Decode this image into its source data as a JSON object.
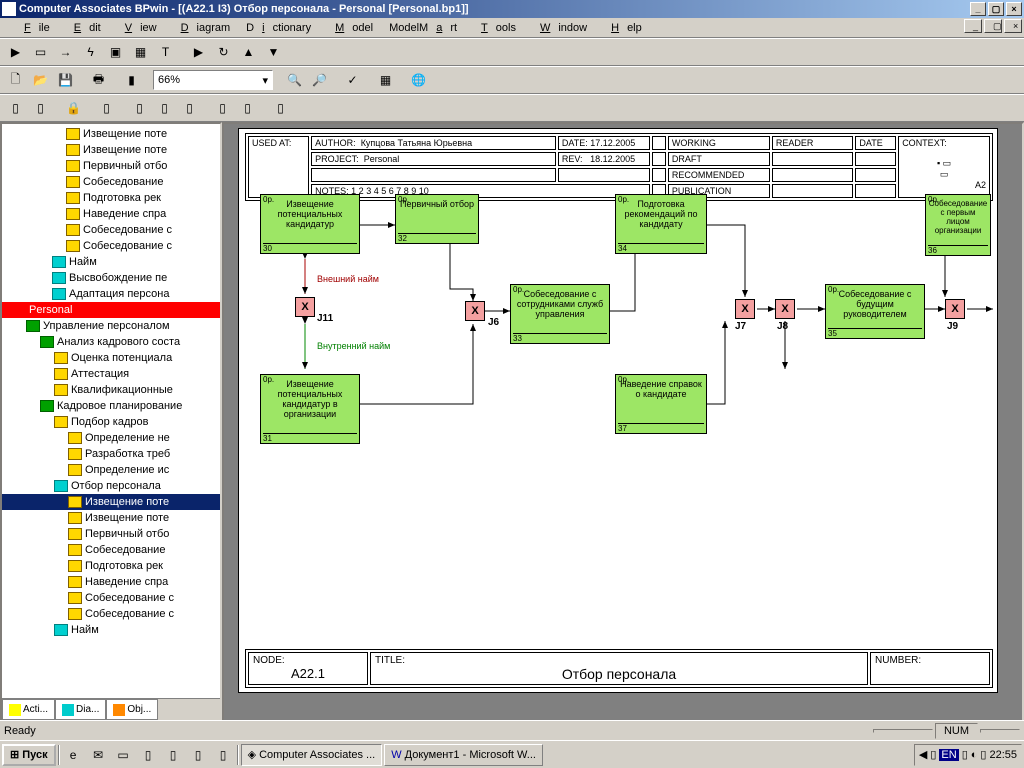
{
  "title": "Computer Associates BPwin - [(A22.1 I3) Отбор персонала - Personal  [Personal.bp1]]",
  "menu": [
    "File",
    "Edit",
    "View",
    "Diagram",
    "Dictionary",
    "Model",
    "ModelMart",
    "Tools",
    "Window",
    "Help"
  ],
  "zoom": "66%",
  "tree": [
    {
      "indent": 64,
      "ic": "ic-yellow",
      "t": "Извещение поте"
    },
    {
      "indent": 64,
      "ic": "ic-yellow",
      "t": "Извещение поте"
    },
    {
      "indent": 64,
      "ic": "ic-yellow",
      "t": "Первичный отбо"
    },
    {
      "indent": 64,
      "ic": "ic-yellow",
      "t": "Собеседование"
    },
    {
      "indent": 64,
      "ic": "ic-yellow",
      "t": "Подготовка рек"
    },
    {
      "indent": 64,
      "ic": "ic-yellow",
      "t": "Наведение спра"
    },
    {
      "indent": 64,
      "ic": "ic-yellow",
      "t": "Собеседование с"
    },
    {
      "indent": 64,
      "ic": "ic-yellow",
      "t": "Собеседование с"
    },
    {
      "indent": 50,
      "ic": "ic-cyan",
      "t": "Найм"
    },
    {
      "indent": 50,
      "ic": "ic-cyan",
      "t": "Высвобождение пе"
    },
    {
      "indent": 50,
      "ic": "ic-cyan",
      "t": "Адаптация персона"
    },
    {
      "indent": 10,
      "ic": "",
      "t": "Personal",
      "cls": "sel-red"
    },
    {
      "indent": 24,
      "ic": "ic-green",
      "t": "Управление персоналом"
    },
    {
      "indent": 38,
      "ic": "ic-green",
      "t": "Анализ кадрового соста"
    },
    {
      "indent": 52,
      "ic": "ic-yellow",
      "t": "Оценка потенциала"
    },
    {
      "indent": 52,
      "ic": "ic-yellow",
      "t": "Аттестация"
    },
    {
      "indent": 52,
      "ic": "ic-yellow",
      "t": "Квалификационные"
    },
    {
      "indent": 38,
      "ic": "ic-green",
      "t": "Кадровое планирование"
    },
    {
      "indent": 52,
      "ic": "ic-yellow",
      "t": "Подбор кадров"
    },
    {
      "indent": 66,
      "ic": "ic-yellow",
      "t": "Определение не"
    },
    {
      "indent": 66,
      "ic": "ic-yellow",
      "t": "Разработка треб"
    },
    {
      "indent": 66,
      "ic": "ic-yellow",
      "t": "Определение ис"
    },
    {
      "indent": 52,
      "ic": "ic-cyan",
      "t": "Отбор персонала"
    },
    {
      "indent": 66,
      "ic": "ic-yellow",
      "t": "Извещение поте",
      "cls": "sel-blue"
    },
    {
      "indent": 66,
      "ic": "ic-yellow",
      "t": "Извещение поте"
    },
    {
      "indent": 66,
      "ic": "ic-yellow",
      "t": "Первичный отбо"
    },
    {
      "indent": 66,
      "ic": "ic-yellow",
      "t": "Собеседование"
    },
    {
      "indent": 66,
      "ic": "ic-yellow",
      "t": "Подготовка рек"
    },
    {
      "indent": 66,
      "ic": "ic-yellow",
      "t": "Наведение спра"
    },
    {
      "indent": 66,
      "ic": "ic-yellow",
      "t": "Собеседование с"
    },
    {
      "indent": 66,
      "ic": "ic-yellow",
      "t": "Собеседование с"
    },
    {
      "indent": 52,
      "ic": "ic-cyan",
      "t": "Найм"
    }
  ],
  "tabs": [
    {
      "l": "Acti..."
    },
    {
      "l": "Dia..."
    },
    {
      "l": "Obj..."
    }
  ],
  "header": {
    "used_at": "USED AT:",
    "author_l": "AUTHOR:",
    "author": "Купцова Татьяна Юрьевна",
    "project_l": "PROJECT:",
    "project": "Personal",
    "date_l": "DATE:",
    "date": "17.12.2005",
    "rev_l": "REV:",
    "rev": "18.12.2005",
    "working": "WORKING",
    "draft": "DRAFT",
    "recommended": "RECOMMENDED",
    "publication": "PUBLICATION",
    "reader": "READER",
    "hdate": "DATE",
    "context": "CONTEXT:",
    "notes": "NOTES:  1  2  3  4  5  6  7  8  9  10",
    "a2": "A2"
  },
  "boxes": {
    "b30": {
      "t": "Извещение потенциальных кандидатур",
      "n": "30"
    },
    "b31": {
      "t": "Извещение потенциальных кандидатур в организации",
      "n": "31"
    },
    "b32": {
      "t": "Первичный отбор",
      "n": "32"
    },
    "b33": {
      "t": "Собеседование с сотрудниками служб управления",
      "n": "33"
    },
    "b34": {
      "t": "Подготовка рекомендаций по кандидату",
      "n": "34"
    },
    "b35": {
      "t": "Собеседование с будущим руководителем",
      "n": "35"
    },
    "b36": {
      "t": "Собеседование с первым лицом организации",
      "n": "36"
    },
    "b37": {
      "t": "Наведение справок о кандидате",
      "n": "37"
    }
  },
  "junc": {
    "x": "X",
    "j11": "J11",
    "j6": "J6",
    "j7": "J7",
    "j8": "J8",
    "j9": "J9"
  },
  "labels": {
    "ext": "Внешний найм",
    "int": "Внутренний найм"
  },
  "footer": {
    "node_l": "NODE:",
    "node": "A22.1",
    "title_l": "TITLE:",
    "title": "Отбор персонала",
    "number_l": "NUMBER:"
  },
  "status": {
    "ready": "Ready",
    "num": "NUM"
  },
  "taskbar": {
    "start": "Пуск",
    "app1": "Computer Associates ...",
    "app2": "Документ1 - Microsoft W...",
    "time": "22:55",
    "lang": "EN"
  }
}
